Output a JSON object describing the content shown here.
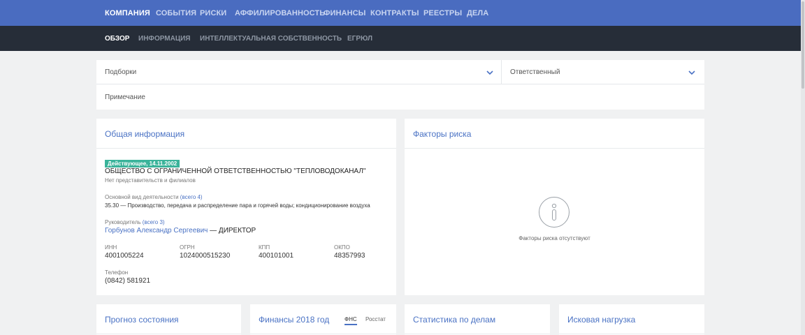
{
  "nav": {
    "tabs": [
      "КОМПАНИЯ",
      "СОБЫТИЯ",
      "РИСКИ",
      "АФФИЛИРОВАННОСТЬ",
      "ФИНАНСЫ",
      "КОНТРАКТЫ",
      "РЕЕСТРЫ",
      "ДЕЛА"
    ],
    "active": "КОМПАНИЯ"
  },
  "subnav": {
    "tabs": [
      "ОБЗОР",
      "ИНФОРМАЦИЯ",
      "ИНТЕЛЛЕКТУАЛЬНАЯ СОБСТВЕННОСТЬ",
      "ЕГРЮЛ"
    ],
    "active": "ОБЗОР"
  },
  "filters": {
    "collections": "Подборки",
    "responsible": "Ответственный",
    "note_placeholder": "Примечание"
  },
  "general": {
    "title": "Общая информация",
    "status": "Действующее, 14.11.2002",
    "company_name": "ОБЩЕСТВО С ОГРАНИЧЕННОЙ ОТВЕТСТВЕННОСТЬЮ \"ТЕПЛОВОДОКАНАЛ\"",
    "branches": "Нет представительств и филиалов",
    "activity_label": "Основной вид деятельности",
    "activity_count": "(всего 4)",
    "activity": "35.30 — Производство, передача и распределение пара и горячей воды; кондиционирование воздуха",
    "head_label": "Руководитель",
    "head_count": "(всего 3)",
    "head_name": "Горбунов Александр Сергеевич",
    "head_role": " — ДИРЕКТОР",
    "codes": {
      "inn_label": "ИНН",
      "inn": "4001005224",
      "ogrn_label": "ОГРН",
      "ogrn": "1024000515230",
      "kpp_label": "КПП",
      "kpp": "400101001",
      "okpo_label": "ОКПО",
      "okpo": "48357993"
    },
    "phone_label": "Телефон",
    "phone": "(0842) 581921"
  },
  "risk": {
    "title": "Факторы риска",
    "empty": "Факторы риска отсутствуют"
  },
  "bottom": {
    "forecast": "Прогноз состояния",
    "finance": "Финансы 2018 год",
    "fin_tab_fns": "ФНС",
    "fin_tab_rosstat": "Росстат",
    "stats": "Статистика по делам",
    "claims": "Исковая нагрузка"
  },
  "colors": {
    "topnav": "#4a6cc0",
    "subnav": "#262d38",
    "accent": "#4a72c4",
    "status_green": "#3ab39a",
    "background": "#f0f1f2"
  }
}
